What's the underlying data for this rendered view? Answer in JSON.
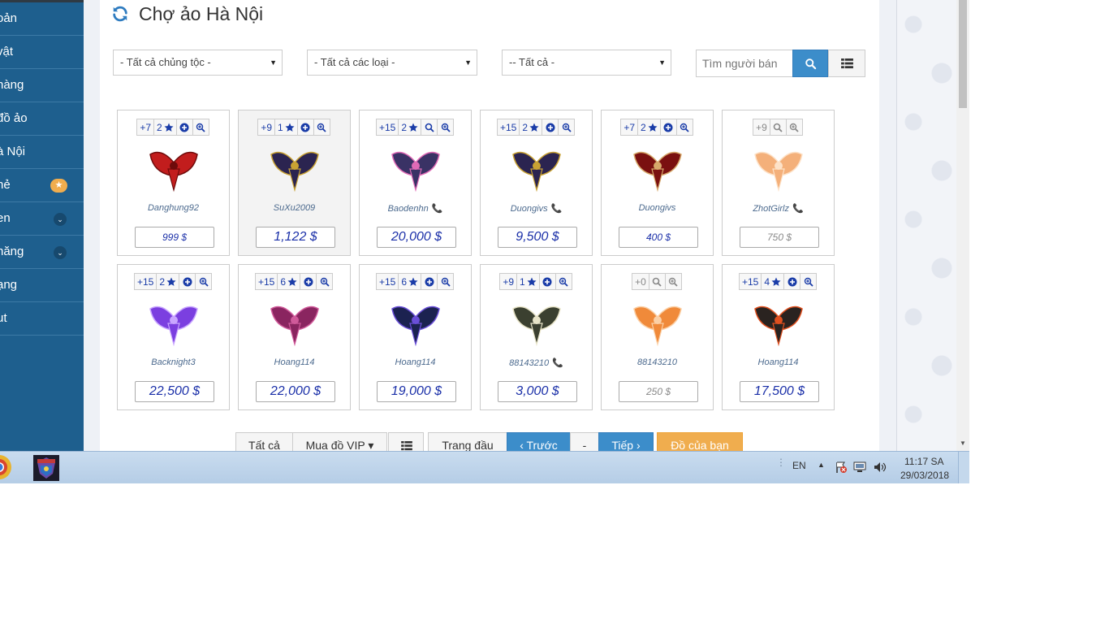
{
  "sidebar": {
    "items": [
      {
        "label": "oản"
      },
      {
        "label": "vật"
      },
      {
        "label": "hàng"
      },
      {
        "label": "đồ ảo"
      },
      {
        "label": "à Nội"
      },
      {
        "label": "hẻ",
        "badge": "★"
      },
      {
        "label": "en",
        "chevron": "⌄"
      },
      {
        "label": "năng",
        "chevron": "⌄"
      },
      {
        "label": "ạng"
      },
      {
        "label": "ut"
      }
    ]
  },
  "header": {
    "title": "Chợ ảo Hà Nội",
    "icon": "refresh-icon"
  },
  "filters": {
    "race": "- Tất cả chủng tộc -",
    "type": "- Tất cả các loại -",
    "other": "-- Tất cả -",
    "search_placeholder": "Tìm người bán"
  },
  "items": [
    {
      "plus": "+7",
      "stars": "2",
      "seller": "Danghung92",
      "phone": false,
      "price": "999 $",
      "small": true
    },
    {
      "plus": "+9",
      "stars": "1",
      "seller": "SuXu2009",
      "phone": false,
      "price": "1,122 $"
    },
    {
      "plus": "+15",
      "stars": "2",
      "seller": "Baodenhn",
      "phone": true,
      "price": "20,000 $"
    },
    {
      "plus": "+15",
      "stars": "2",
      "seller": "Duongivs",
      "phone": true,
      "price": "9,500 $"
    },
    {
      "plus": "+7",
      "stars": "2",
      "seller": "Duongivs",
      "phone": false,
      "price": "400 $",
      "small": true
    },
    {
      "plus": "+9",
      "stars": "",
      "seller": "ZhotGirlz",
      "phone": true,
      "price": "750 $",
      "small": true,
      "muted": true
    },
    {
      "plus": "+15",
      "stars": "2",
      "seller": "Backnight3",
      "phone": false,
      "price": "22,500 $"
    },
    {
      "plus": "+15",
      "stars": "6",
      "seller": "Hoang114",
      "phone": false,
      "price": "22,000 $"
    },
    {
      "plus": "+15",
      "stars": "6",
      "seller": "Hoang114",
      "phone": false,
      "price": "19,000 $"
    },
    {
      "plus": "+9",
      "stars": "1",
      "seller": "88143210",
      "phone": true,
      "price": "3,000 $"
    },
    {
      "plus": "+0",
      "stars": "",
      "seller": "88143210",
      "phone": false,
      "price": "250 $",
      "small": true,
      "muted": true
    },
    {
      "plus": "+15",
      "stars": "4",
      "seller": "Hoang114",
      "phone": false,
      "price": "17,500 $"
    }
  ],
  "pagination": {
    "all": "Tất cả",
    "vip": "Mua đồ VIP ▾",
    "first": "Trang đầu",
    "prev": "‹ Trước",
    "current": "-",
    "next": "Tiếp ›",
    "mine": "Đồ của bạn"
  },
  "taskbar": {
    "lang": "EN",
    "time": "11:17 SA",
    "date": "29/03/2018"
  },
  "colors": {
    "sidebar": "#1e5f8e",
    "accent": "#3c8dca",
    "orange": "#f0ad4e",
    "price": "#1a2fa8"
  }
}
